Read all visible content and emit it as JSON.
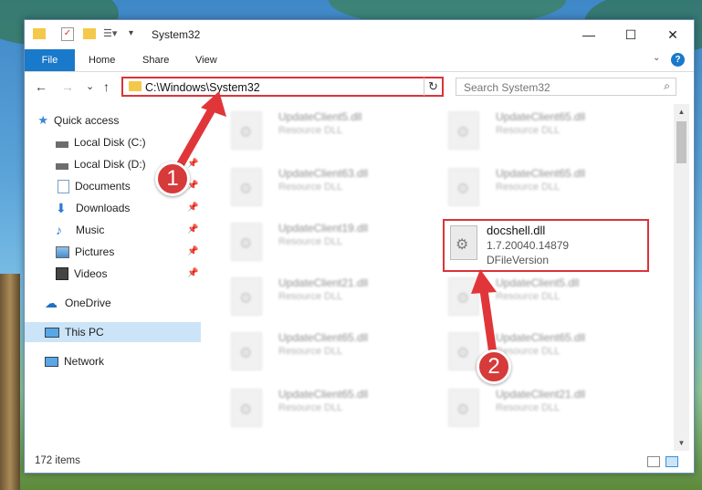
{
  "window": {
    "title": "System32",
    "minimize": "—",
    "maximize": "☐",
    "close": "✕"
  },
  "ribbon": {
    "tabs": [
      "File",
      "Home",
      "Share",
      "View"
    ],
    "expand": "⌄",
    "help": "?"
  },
  "nav": {
    "back": "←",
    "forward": "→",
    "recent": "⌄",
    "up": "↑",
    "address": "C:\\Windows\\System32",
    "dropdown": "⌄",
    "refresh": "↻",
    "search_placeholder": "Search System32",
    "search_icon": "⌕"
  },
  "sidebar": {
    "items": [
      {
        "label": "Quick access",
        "icon": "star-icon"
      },
      {
        "label": "Local Disk (C:)",
        "icon": "drive-icon"
      },
      {
        "label": "Local Disk (D:)",
        "icon": "drive-icon"
      },
      {
        "label": "Documents",
        "icon": "documents-icon"
      },
      {
        "label": "Downloads",
        "icon": "download-icon"
      },
      {
        "label": "Music",
        "icon": "music-icon"
      },
      {
        "label": "Pictures",
        "icon": "pictures-icon"
      },
      {
        "label": "Videos",
        "icon": "videos-icon"
      },
      {
        "label": "OneDrive",
        "icon": "cloud-icon"
      },
      {
        "label": "This PC",
        "icon": "computer-icon"
      },
      {
        "label": "Network",
        "icon": "network-icon"
      }
    ]
  },
  "files": [
    {
      "name": "UpdateClient5.dll",
      "type": "Resource DLL"
    },
    {
      "name": "UpdateClient65.dll",
      "type": "Resource DLL"
    },
    {
      "name": "UpdateClient63.dll",
      "type": "Resource DLL"
    },
    {
      "name": "UpdateClient65.dll",
      "type": "Resource DLL"
    },
    {
      "name": "UpdateClient19.dll",
      "type": "Resource DLL"
    },
    {
      "name": "UpdateClient21.dll",
      "type": "Resource DLL"
    },
    {
      "name": "UpdateClient5.dll",
      "type": "Resource DLL"
    },
    {
      "name": "UpdateClient65.dll",
      "type": "Resource DLL"
    },
    {
      "name": "UpdateClient65.dll",
      "type": "Resource DLL"
    },
    {
      "name": "UpdateClient65.dll",
      "type": "Resource DLL"
    },
    {
      "name": "UpdateClient21.dll",
      "type": "Resource DLL"
    }
  ],
  "highlighted_file": {
    "name": "docshell.dll",
    "version": "1.7.20040.14879",
    "description": "DFileVersion"
  },
  "status": {
    "item_count": "172 items"
  },
  "callouts": [
    "1",
    "2"
  ],
  "colors": {
    "accent": "#1979ca",
    "annotation": "#d9343a",
    "selected": "#cce4f7"
  }
}
